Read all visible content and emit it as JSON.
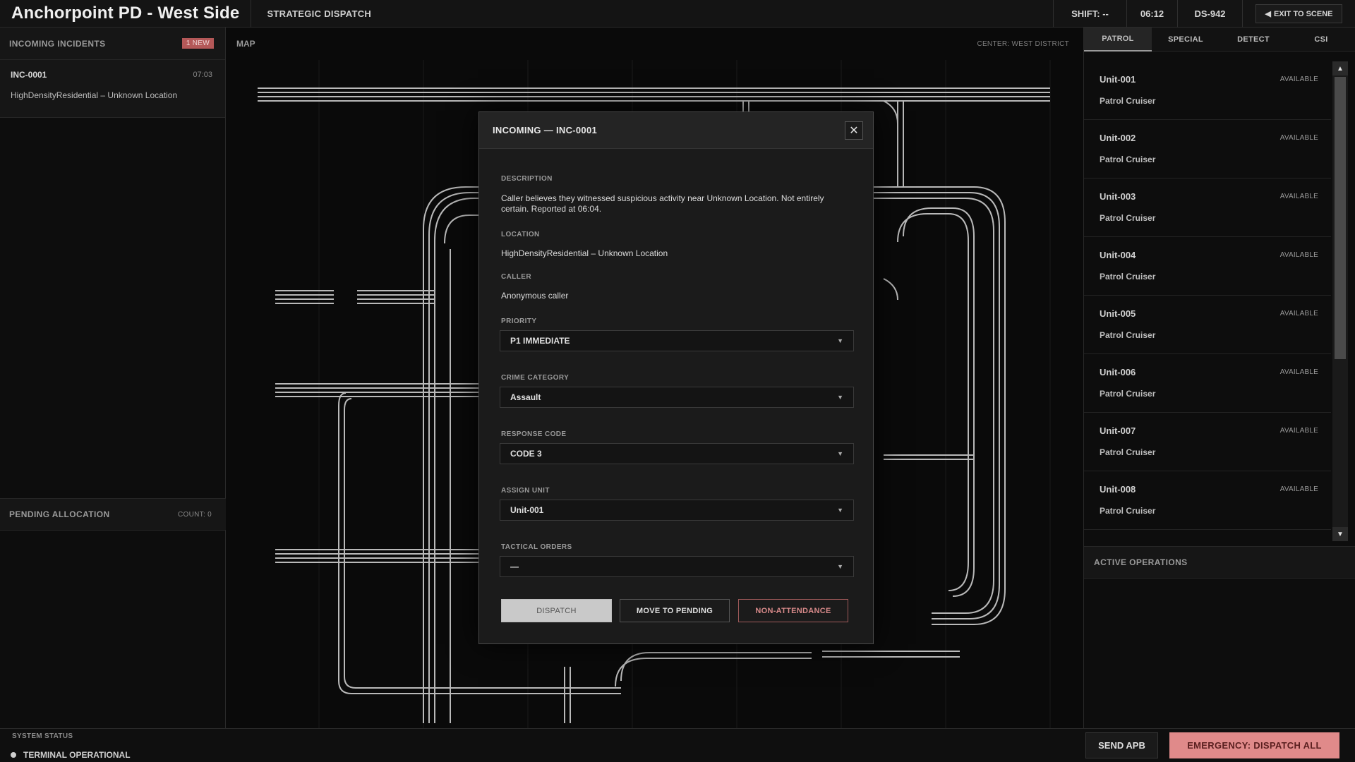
{
  "header": {
    "title": "Anchorpoint PD - West Side",
    "mode": "STRATEGIC DISPATCH",
    "shift": "SHIFT: --",
    "clock": "06:12",
    "terminal_id": "DS-942",
    "exit_label": "EXIT TO SCENE"
  },
  "incoming": {
    "title": "INCOMING INCIDENTS",
    "badge": "1 NEW",
    "items": [
      {
        "id": "INC-0001",
        "time": "07:03",
        "location": "HighDensityResidential – Unknown Location"
      }
    ]
  },
  "pending": {
    "title": "PENDING ALLOCATION",
    "count": "COUNT: 0"
  },
  "map": {
    "title": "MAP",
    "center": "CENTER: WEST DISTRICT"
  },
  "units_panel": {
    "tabs": [
      "PATROL",
      "SPECIAL",
      "DETECT",
      "CSI"
    ],
    "active_tab": "PATROL",
    "units": [
      {
        "name": "Unit-001",
        "status": "AVAILABLE",
        "type": "Patrol Cruiser"
      },
      {
        "name": "Unit-002",
        "status": "AVAILABLE",
        "type": "Patrol Cruiser"
      },
      {
        "name": "Unit-003",
        "status": "AVAILABLE",
        "type": "Patrol Cruiser"
      },
      {
        "name": "Unit-004",
        "status": "AVAILABLE",
        "type": "Patrol Cruiser"
      },
      {
        "name": "Unit-005",
        "status": "AVAILABLE",
        "type": "Patrol Cruiser"
      },
      {
        "name": "Unit-006",
        "status": "AVAILABLE",
        "type": "Patrol Cruiser"
      },
      {
        "name": "Unit-007",
        "status": "AVAILABLE",
        "type": "Patrol Cruiser"
      },
      {
        "name": "Unit-008",
        "status": "AVAILABLE",
        "type": "Patrol Cruiser"
      }
    ],
    "active_ops_title": "ACTIVE OPERATIONS"
  },
  "footer": {
    "system_label": "SYSTEM STATUS",
    "status": "TERMINAL OPERATIONAL",
    "apb_label": "SEND APB",
    "emergency_label": "EMERGENCY: DISPATCH ALL"
  },
  "modal": {
    "title": "INCOMING — INC-0001",
    "description_label": "DESCRIPTION",
    "description": "Caller believes they witnessed suspicious activity near Unknown Location. Not entirely certain. Reported at 06:04.",
    "location_label": "LOCATION",
    "location": "HighDensityResidential – Unknown Location",
    "caller_label": "CALLER",
    "caller": "Anonymous caller",
    "priority_label": "PRIORITY",
    "priority": "P1 IMMEDIATE",
    "crime_label": "CRIME CATEGORY",
    "crime": "Assault",
    "response_label": "RESPONSE CODE",
    "response": "CODE 3",
    "assign_label": "ASSIGN UNIT",
    "assign": "Unit-001",
    "orders_label": "TACTICAL ORDERS",
    "orders": "—",
    "dispatch_label": "DISPATCH",
    "pending_label": "MOVE TO PENDING",
    "nonattendance_label": "NON-ATTENDANCE"
  },
  "colors": {
    "background": "#0b0b0b",
    "panel": "#161616",
    "badge": "#b45858",
    "emergency": "#e08a8a",
    "non_attendance": "#d88a8a"
  }
}
